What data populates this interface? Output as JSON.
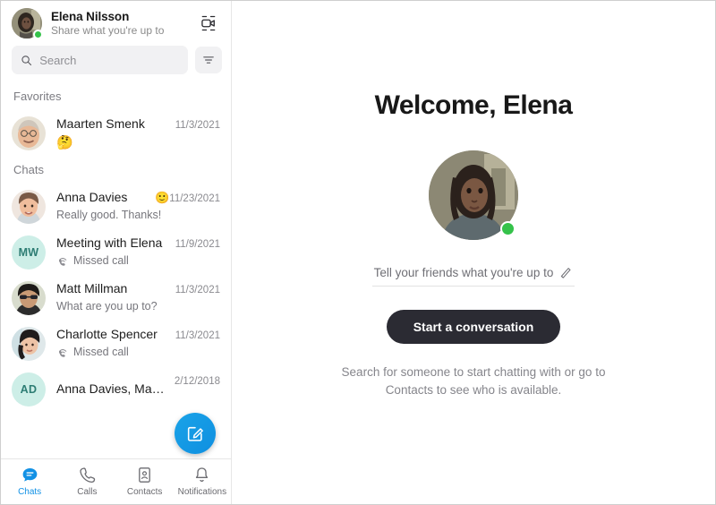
{
  "sidebar": {
    "profile": {
      "name": "Elena Nilsson",
      "status_text": "Share what you're up to",
      "presence": "online",
      "presence_color": "#35c24a",
      "avatar_name": "elena-avatar",
      "meet_now_icon": "video-camera-icon"
    },
    "search": {
      "placeholder": "Search",
      "value": "",
      "search_icon": "search-icon",
      "filter_icon": "filter-icon"
    },
    "sections": [
      {
        "title": "Favorites",
        "rows": [
          {
            "name": "Maarten Smenk",
            "name_emoji": "",
            "preview": "🤔",
            "preview_is_emoji": true,
            "preview_icon": "",
            "date": "11/3/2021",
            "avatar_type": "photo",
            "avatar_name": "maarten-avatar",
            "initials": ""
          }
        ]
      },
      {
        "title": "Chats",
        "rows": [
          {
            "name": "Anna Davies",
            "name_emoji": "🙂",
            "preview": "Really good. Thanks!",
            "preview_is_emoji": false,
            "preview_icon": "",
            "date": "11/23/2021",
            "avatar_type": "photo",
            "avatar_name": "anna-avatar",
            "initials": ""
          },
          {
            "name": "Meeting with Elena",
            "name_emoji": "",
            "preview": "Missed call",
            "preview_is_emoji": false,
            "preview_icon": "missed-call-icon",
            "date": "11/9/2021",
            "avatar_type": "initials",
            "avatar_name": "meeting-avatar",
            "initials": "MW"
          },
          {
            "name": "Matt Millman",
            "name_emoji": "",
            "preview": "What are you up to?",
            "preview_is_emoji": false,
            "preview_icon": "",
            "date": "11/3/2021",
            "avatar_type": "photo",
            "avatar_name": "matt-avatar",
            "initials": ""
          },
          {
            "name": "Charlotte Spencer",
            "name_emoji": "",
            "preview": "Missed call",
            "preview_is_emoji": false,
            "preview_icon": "missed-call-icon",
            "date": "11/3/2021",
            "avatar_type": "photo",
            "avatar_name": "charlotte-avatar",
            "initials": ""
          },
          {
            "name": "Anna Davies, Maarten...",
            "name_emoji": "",
            "preview": "",
            "preview_is_emoji": false,
            "preview_icon": "",
            "date": "2/12/2018",
            "avatar_type": "initials",
            "avatar_name": "group-avatar",
            "initials": "AD"
          }
        ]
      }
    ],
    "compose_button": {
      "icon": "compose-icon",
      "color": "#1294e4"
    },
    "bottom_nav": [
      {
        "label": "Chats",
        "icon": "chat-bubble-icon",
        "active": true
      },
      {
        "label": "Calls",
        "icon": "phone-icon",
        "active": false
      },
      {
        "label": "Contacts",
        "icon": "contacts-card-icon",
        "active": false
      },
      {
        "label": "Notifications",
        "icon": "bell-icon",
        "active": false
      }
    ],
    "nav_active_color": "#1291e5"
  },
  "main": {
    "title": "Welcome, Elena",
    "avatar_name": "elena-hero-avatar",
    "presence_color": "#35c24a",
    "mood_placeholder": "Tell your friends what you're up to",
    "mood_edit_icon": "pencil-icon",
    "cta_label": "Start a conversation",
    "cta_color": "#2b2b33",
    "helper_line1": "Search for someone to start chatting with or go to",
    "helper_line2": "Contacts to see who is available."
  }
}
